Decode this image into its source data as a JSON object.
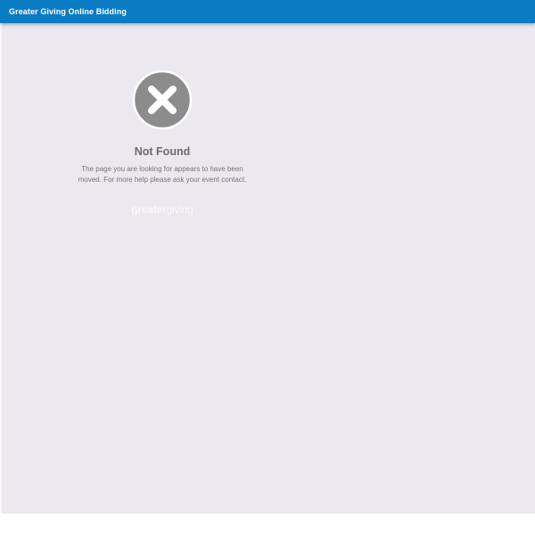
{
  "header": {
    "title": "Greater Giving Online Bidding"
  },
  "error": {
    "icon": "close-circle-icon",
    "title": "Not Found",
    "message": "The page you are looking for appears to have been moved. For more help please ask your event contact."
  },
  "logo": {
    "part1": "greater",
    "part2": "giving"
  },
  "colors": {
    "header_bg": "#0a7cc4",
    "page_bg": "#ebe9ee",
    "icon_gray": "#8c8c8c"
  }
}
